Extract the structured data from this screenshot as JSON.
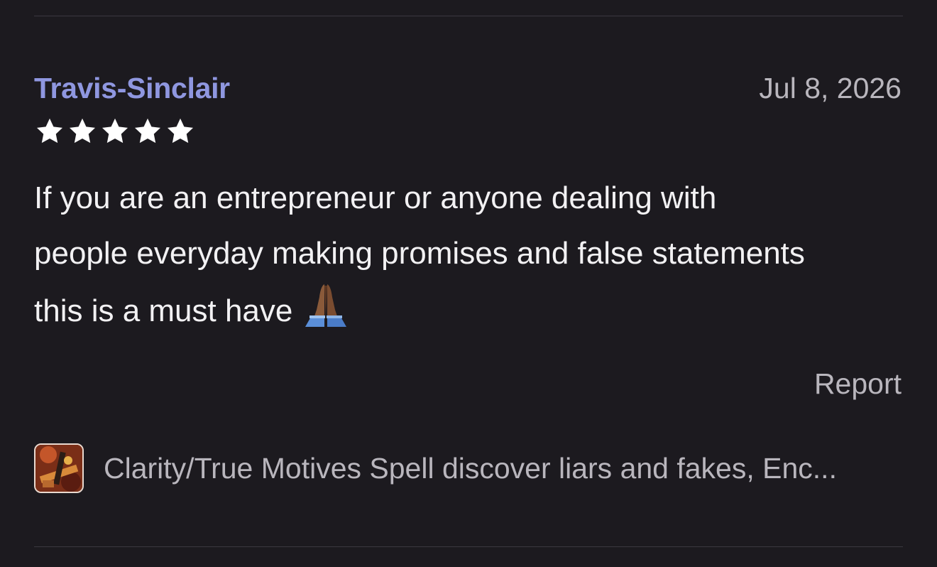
{
  "review": {
    "reviewer_name": "Travis-Sinclair",
    "date": "Jul 8, 2026",
    "rating": 5,
    "rating_max": 5,
    "text_line1": "If you are an entrepreneur or anyone dealing with",
    "text_line2": "people everyday making promises and false statements",
    "text_line3": "this is a must have",
    "emoji": "folded-hands-icon",
    "report_label": "Report"
  },
  "product": {
    "title": "Clarity/True Motives Spell discover liars and fakes, Enc..."
  },
  "colors": {
    "background": "#1c1a1f",
    "reviewer_name": "#8f97e0",
    "muted_text": "#b9b6bd",
    "body_text": "#f2f1f3",
    "star": "#ffffff",
    "divider": "#3b3840"
  }
}
